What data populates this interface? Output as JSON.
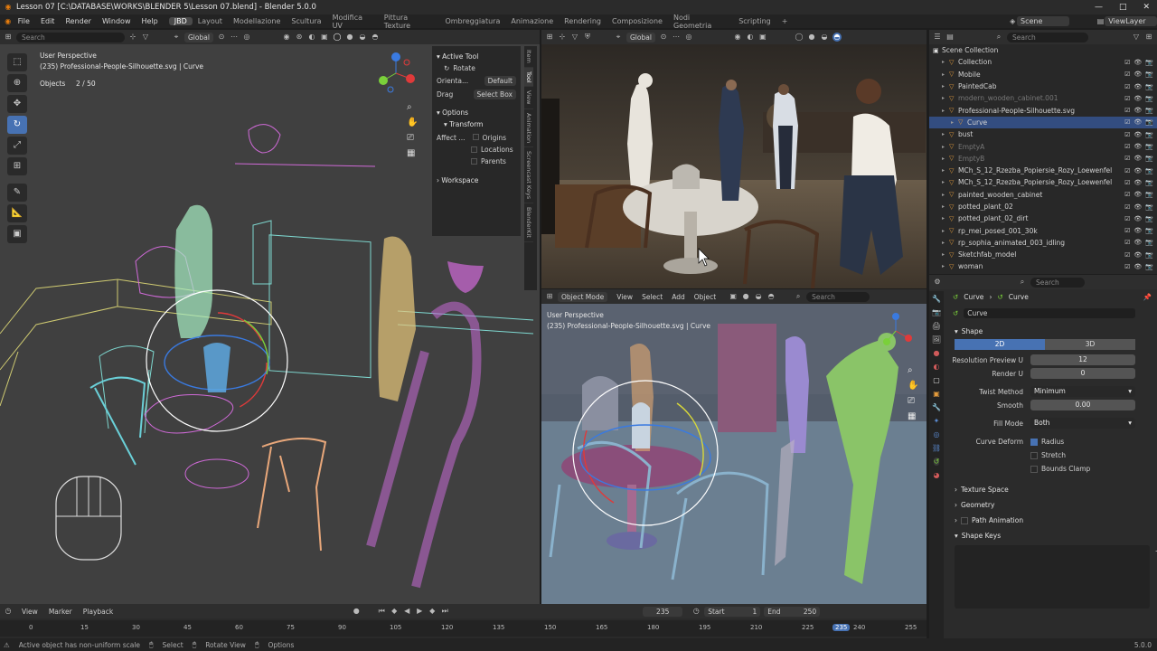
{
  "window": {
    "title": "Lesson 07 [C:\\DATABASE\\WORKS\\BLENDER 5\\Lesson 07.blend] - Blender 5.0.0",
    "controls": [
      "—",
      "□",
      "✕"
    ]
  },
  "menu": {
    "items": [
      "File",
      "Edit",
      "Render",
      "Window",
      "Help"
    ],
    "workspaces": [
      "JBD",
      "Layout",
      "Modellazione",
      "Scultura",
      "Modifica UV",
      "Pittura Texture",
      "Ombreggiatura",
      "Animazione",
      "Rendering",
      "Composizione",
      "Nodi Geometria",
      "Scripting"
    ],
    "active_workspace": "JBD",
    "add_tab": "+",
    "scene": "Scene",
    "view_layer": "ViewLayer"
  },
  "left_viewport": {
    "search_placeholder": "Search",
    "orientation": "Global",
    "perspective": "User Perspective",
    "object_info": "(235) Professional-People-Silhouette.svg | Curve",
    "objects_label": "Objects",
    "objects_value": "2 / 50",
    "tool_panel": {
      "active_tool": "Active Tool",
      "tool_name": "Rotate",
      "orientation_label": "Orienta...",
      "orientation_value": "Default",
      "drag_label": "Drag",
      "drag_value": "Select Box",
      "options": "Options",
      "transform": "Transform",
      "affect_label": "Affect ...",
      "affect_options": [
        "Origins",
        "Locations",
        "Parents"
      ],
      "workspace": "Workspace"
    },
    "side_tabs": [
      "Item",
      "Tool",
      "View",
      "Animation",
      "Screencast Keys",
      "BlenderKit"
    ]
  },
  "right_top_viewport": {
    "orientation": "Global"
  },
  "right_bottom_viewport": {
    "mode": "Object Mode",
    "menus": [
      "View",
      "Select",
      "Add",
      "Object"
    ],
    "search_placeholder": "Search",
    "perspective": "User Perspective",
    "object_info": "(235) Professional-People-Silhouette.svg | Curve"
  },
  "outliner": {
    "search_placeholder": "Search",
    "root": "Scene Collection",
    "rows": [
      {
        "name": "Collection",
        "indent": 1,
        "dim": false,
        "selected": false
      },
      {
        "name": "Mobile",
        "indent": 1,
        "dim": false,
        "selected": false
      },
      {
        "name": "PaintedCab",
        "indent": 1,
        "dim": false,
        "selected": false
      },
      {
        "name": "modern_wooden_cabinet.001",
        "indent": 1,
        "dim": true,
        "selected": false
      },
      {
        "name": "Professional-People-Silhouette.svg",
        "indent": 1,
        "dim": false,
        "selected": false
      },
      {
        "name": "Curve",
        "indent": 2,
        "dim": false,
        "selected": true
      },
      {
        "name": "bust",
        "indent": 1,
        "dim": false,
        "selected": false
      },
      {
        "name": "EmptyA",
        "indent": 1,
        "dim": true,
        "selected": false
      },
      {
        "name": "EmptyB",
        "indent": 1,
        "dim": true,
        "selected": false
      },
      {
        "name": "MCh_S_12_Rzezba_Popiersie_Rozy_Loewenfel",
        "indent": 1,
        "dim": false,
        "selected": false
      },
      {
        "name": "MCh_S_12_Rzezba_Popiersie_Rozy_Loewenfel",
        "indent": 1,
        "dim": false,
        "selected": false
      },
      {
        "name": "painted_wooden_cabinet",
        "indent": 1,
        "dim": false,
        "selected": false
      },
      {
        "name": "potted_plant_02",
        "indent": 1,
        "dim": false,
        "selected": false
      },
      {
        "name": "potted_plant_02_dirt",
        "indent": 1,
        "dim": false,
        "selected": false
      },
      {
        "name": "rp_mei_posed_001_30k",
        "indent": 1,
        "dim": false,
        "selected": false
      },
      {
        "name": "rp_sophia_animated_003_idling",
        "indent": 1,
        "dim": false,
        "selected": false
      },
      {
        "name": "Sketchfab_model",
        "indent": 1,
        "dim": false,
        "selected": false
      },
      {
        "name": "woman",
        "indent": 1,
        "dim": false,
        "selected": false
      }
    ]
  },
  "properties": {
    "search_placeholder": "Search",
    "breadcrumb": [
      "Curve",
      "Curve"
    ],
    "datablock": "Curve",
    "shape_panel": "Shape",
    "dim_options": [
      "2D",
      "3D"
    ],
    "dim_active": "2D",
    "fields": [
      {
        "label": "Resolution Preview U",
        "value": "12"
      },
      {
        "label": "Render U",
        "value": "0"
      }
    ],
    "twist_method_label": "Twist Method",
    "twist_method_value": "Minimum",
    "smooth_label": "Smooth",
    "smooth_value": "0.00",
    "fill_mode_label": "Fill Mode",
    "fill_mode_value": "Both",
    "curve_deform_label": "Curve Deform",
    "curve_deform_options": [
      {
        "label": "Radius",
        "checked": true
      },
      {
        "label": "Stretch",
        "checked": false
      },
      {
        "label": "Bounds Clamp",
        "checked": false
      }
    ],
    "collapsed_panels": [
      "Texture Space",
      "Geometry",
      "Path Animation",
      "Shape Keys"
    ]
  },
  "timeline": {
    "menus": [
      "View",
      "Marker",
      "Playback"
    ],
    "current_frame": "235",
    "start_label": "Start",
    "start_value": "1",
    "end_label": "End",
    "end_value": "250",
    "ticks": [
      "0",
      "15",
      "30",
      "45",
      "60",
      "75",
      "90",
      "105",
      "120",
      "135",
      "150",
      "165",
      "180",
      "195",
      "210",
      "225",
      "235",
      "240",
      "255"
    ]
  },
  "statusbar": {
    "message": "Active object has non-uniform scale",
    "hints": [
      "Select",
      "Rotate View",
      "Options"
    ],
    "version": "5.0.0"
  }
}
